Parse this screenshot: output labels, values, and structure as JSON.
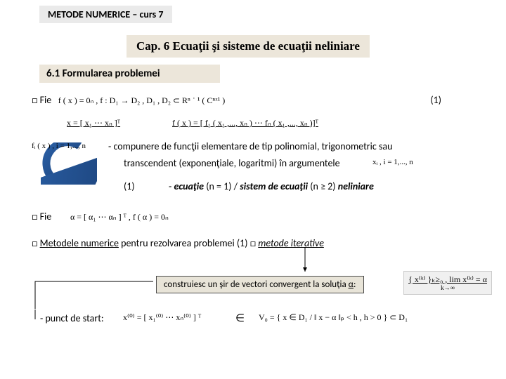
{
  "header": "METODE  NUMERICE – curs 7",
  "chapter": "Cap. 6  Ecuaţii şi sisteme de ecuaţii neliniare",
  "section": "6.1  Formularea problemei",
  "fie1_prefix": "□  Fie",
  "fie1_math": "f ( x ) = 0ₙ ,    f : D₁ → D₂ ,    D₁ , D₂  ⊂  Rⁿ ˙ ¹  ( Cⁿˣ¹ )",
  "eq1_label": "(1)",
  "x_def": "x = [ x₁   ⋯   xₙ ]ᵀ",
  "f_def": "f ( x ) = [ f₁ ( x₁ ,..., xₙ )   ⋯   fₙ ( x₁ ,..., xₙ )]ᵀ",
  "fi_small": "fᵢ ( x ) ,  i = 1,..., n",
  "comp_line": " - compunere de funcţii elementare de tip polinomial, trigonometric sau",
  "comp_line2": "transcendent (exponenţiale, logaritmi) în argumentele",
  "xi_small": "xᵢ ,  i = 1,..., n",
  "eq_one": "(1)",
  "eq_desc_a": "- ",
  "eq_desc_b": "ecuaţie",
  "eq_desc_c": " (n = 1) / ",
  "eq_desc_d": "sistem de ecuaţii",
  "eq_desc_e": " (n ≥ 2) ",
  "eq_desc_f": "neliniare",
  "fie2_prefix": "□  Fie",
  "alpha_math": "α = [ α₁   ⋯   αₙ ] ᵀ ,      f ( α ) = 0ₙ",
  "line3_a": "□  ",
  "line3_b": "Metodele numerice",
  "line3_c": " pentru rezolvarea problemei (1) □ ",
  "line3_d": "metode iterative",
  "builds_a": "construiesc un şir de vectori convergent la soluţia ",
  "builds_b": "α",
  "builds_c": ":",
  "lim_expr": "{ x⁽ᵏ⁾ }ₖ≥₀ ,  lim  x⁽ᵏ⁾ = α",
  "lim_sub": "k→∞",
  "start": "- punct de start:",
  "start_math": "x⁽⁰⁾ = [ x₁⁽⁰⁾   ⋯   xₙ⁽⁰⁾ ] ᵀ",
  "in_sym": "∈",
  "vo_math": "V₀ = { x ∈ D₁  /   ‖ x − α ‖ₚ < h ,  h > 0 } ⊂ D₁"
}
